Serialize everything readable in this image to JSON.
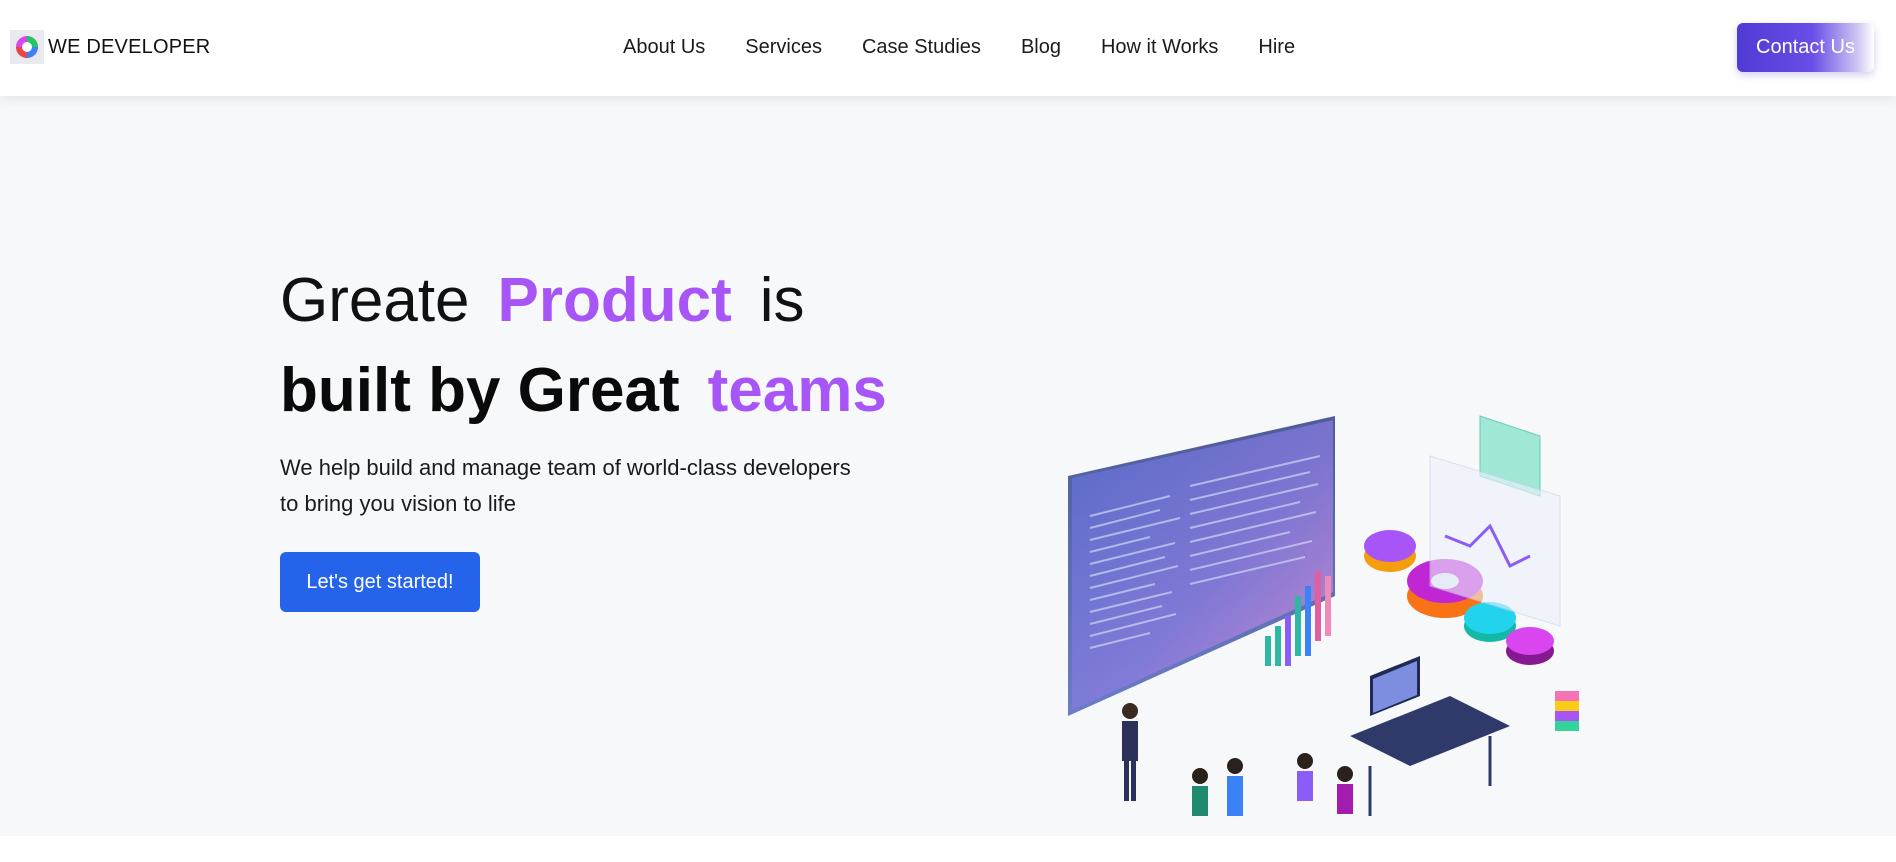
{
  "brand": {
    "name": "WE DEVELOPER",
    "logo_icon": "brand-logo-icon"
  },
  "nav": {
    "items": [
      {
        "label": "About Us"
      },
      {
        "label": "Services"
      },
      {
        "label": "Case Studies"
      },
      {
        "label": "Blog"
      },
      {
        "label": "How it Works"
      },
      {
        "label": "Hire"
      }
    ],
    "contact_label": "Contact Us"
  },
  "hero": {
    "line1": {
      "word1": "Greate",
      "accent": "Product",
      "word2": "is"
    },
    "line2": {
      "text": "built by Great",
      "accent": "teams"
    },
    "subtitle_line1": "We help build and manage team of world-class developers",
    "subtitle_line2": "to bring you vision to life",
    "cta_label": "Let's get started!",
    "illustration": "team-collaboration-illustration"
  },
  "colors": {
    "accent_purple": "#a855f7",
    "cta_blue": "#2563eb",
    "contact_gradient_start": "#4f3bd4"
  }
}
